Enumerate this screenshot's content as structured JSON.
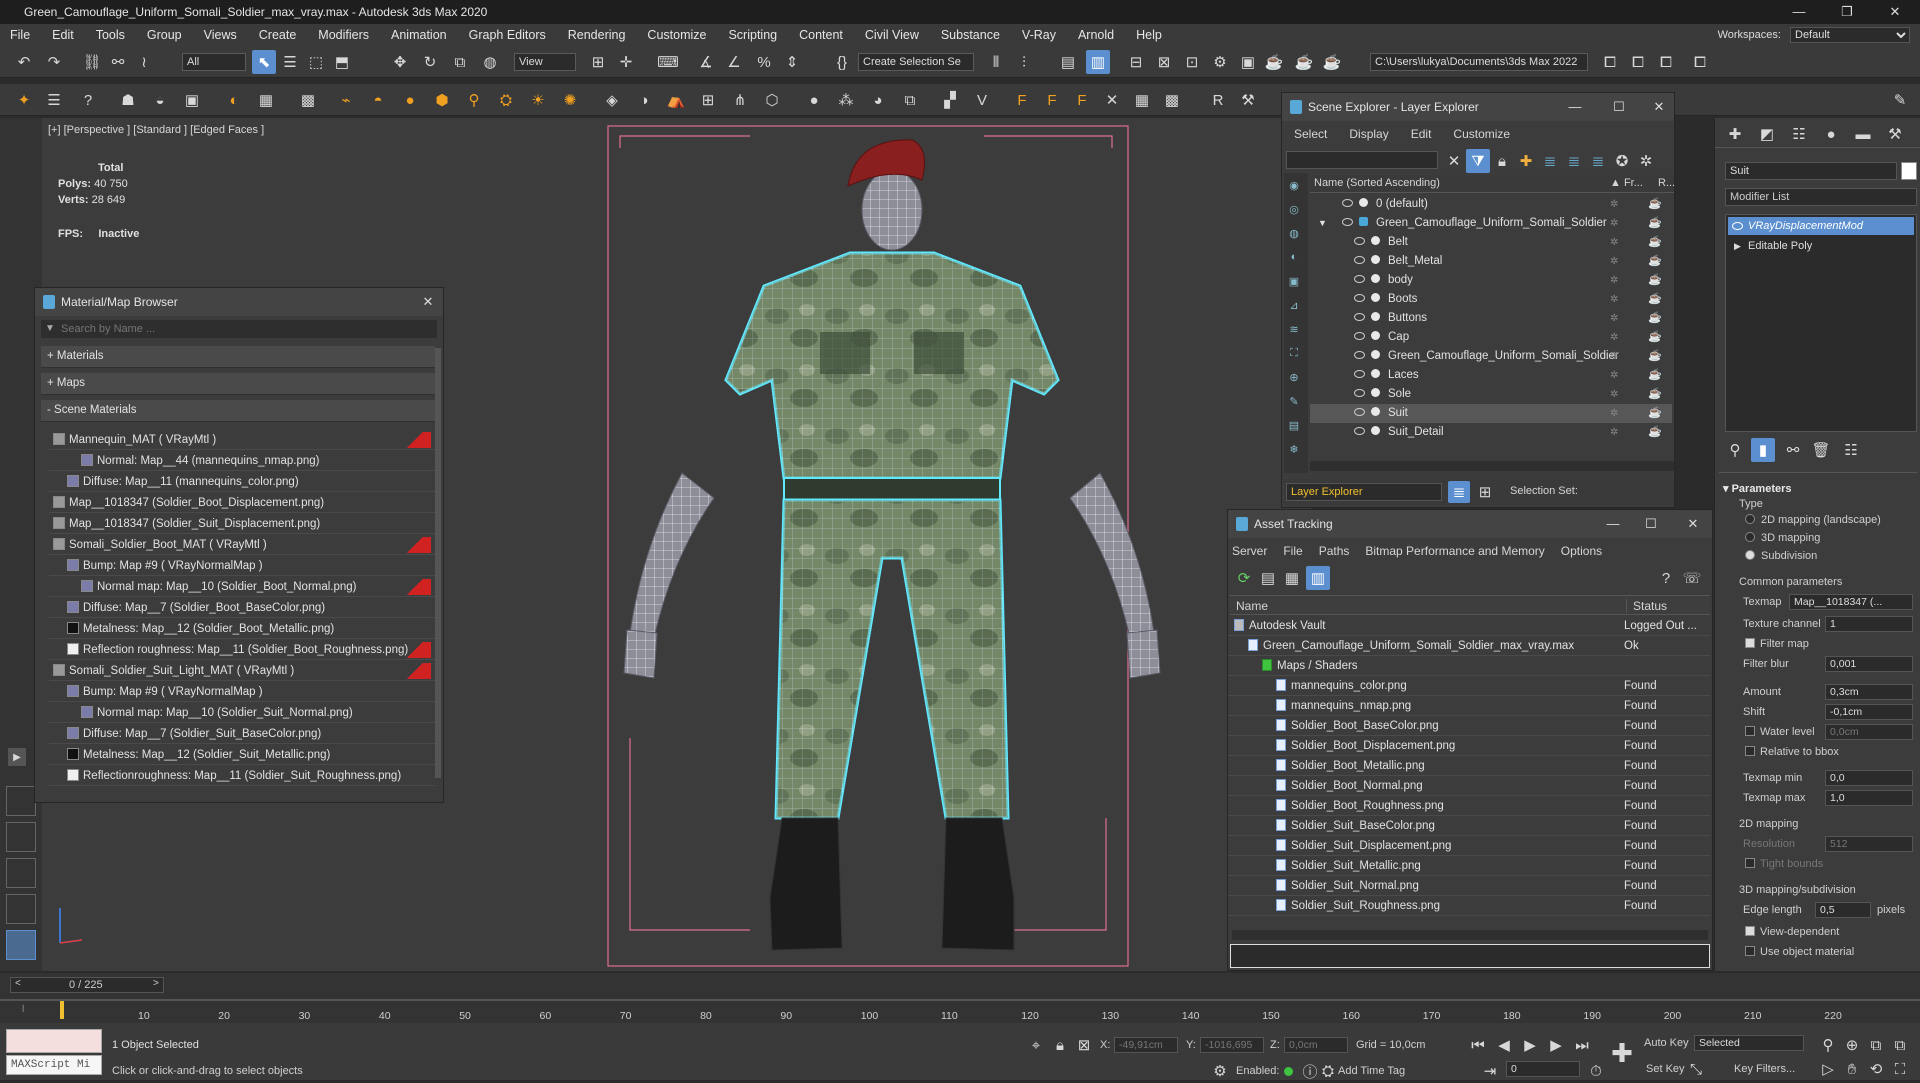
{
  "window": {
    "title": "Green_Camouflage_Uniform_Somali_Soldier_max_vray.max - Autodesk 3ds Max 2020"
  },
  "menu": [
    "File",
    "Edit",
    "Tools",
    "Group",
    "Views",
    "Create",
    "Modifiers",
    "Animation",
    "Graph Editors",
    "Rendering",
    "Customize",
    "Scripting",
    "Content",
    "Civil View",
    "Substance",
    "V-Ray",
    "Arnold",
    "Help"
  ],
  "workspace": {
    "label": "Workspaces:",
    "value": "Default"
  },
  "toolbar": {
    "filter": "All",
    "refcoord": "View",
    "selection_set": "Create Selection Se",
    "path": "C:\\Users\\lukya\\Documents\\3ds Max 2022"
  },
  "viewport": {
    "label": "[+] [Perspective ] [Standard ] [Edged Faces ]",
    "stats": {
      "total": "Total",
      "polys_label": "Polys:",
      "polys": "40 750",
      "verts_label": "Verts:",
      "verts": "28 649",
      "fps_label": "FPS:",
      "fps": "Inactive"
    }
  },
  "material_browser": {
    "title": "Material/Map Browser",
    "search_placeholder": "Search by Name ...",
    "groups": [
      "+ Materials",
      "+ Maps",
      "- Scene Materials"
    ],
    "items": [
      {
        "text": "Mannequin_MAT ( VRayMtl )",
        "indent": 0,
        "flag": true
      },
      {
        "text": "Normal: Map__44 (mannequins_nmap.png)",
        "indent": 2,
        "flag": false
      },
      {
        "text": "Diffuse: Map__11 (mannequins_color.png)",
        "indent": 1,
        "flag": false
      },
      {
        "text": "Map__1018347 (Soldier_Boot_Displacement.png)",
        "indent": 0,
        "flag": false
      },
      {
        "text": "Map__1018347 (Soldier_Suit_Displacement.png)",
        "indent": 0,
        "flag": false
      },
      {
        "text": "Somali_Soldier_Boot_MAT ( VRayMtl )",
        "indent": 0,
        "flag": true
      },
      {
        "text": "Bump: Map #9 ( VRayNormalMap )",
        "indent": 1,
        "flag": false
      },
      {
        "text": "Normal map: Map__10 (Soldier_Boot_Normal.png)",
        "indent": 2,
        "flag": true
      },
      {
        "text": "Diffuse: Map__7 (Soldier_Boot_BaseColor.png)",
        "indent": 1,
        "flag": false
      },
      {
        "text": "Metalness: Map__12 (Soldier_Boot_Metallic.png)",
        "indent": 1,
        "flag": false
      },
      {
        "text": "Reflection roughness: Map__11 (Soldier_Boot_Roughness.png)",
        "indent": 1,
        "flag": true
      },
      {
        "text": "Somali_Soldier_Suit_Light_MAT ( VRayMtl )",
        "indent": 0,
        "flag": true
      },
      {
        "text": "Bump: Map #9 ( VRayNormalMap )",
        "indent": 1,
        "flag": false
      },
      {
        "text": "Normal map: Map__10 (Soldier_Suit_Normal.png)",
        "indent": 2,
        "flag": false
      },
      {
        "text": "Diffuse: Map__7 (Soldier_Suit_BaseColor.png)",
        "indent": 1,
        "flag": false
      },
      {
        "text": "Metalness: Map__12 (Soldier_Suit_Metallic.png)",
        "indent": 1,
        "flag": false
      },
      {
        "text": "Reflectionroughness: Map__11 (Soldier_Suit_Roughness.png)",
        "indent": 1,
        "flag": false
      }
    ]
  },
  "scene_explorer": {
    "title": "Scene Explorer - Layer Explorer",
    "menu": [
      "Select",
      "Display",
      "Edit",
      "Customize"
    ],
    "col_name": "Name (Sorted Ascending)",
    "col_fr": "▲ Fr...",
    "col_r": "R...",
    "rows": [
      {
        "name": "0 (default)",
        "level": 0,
        "selected": false
      },
      {
        "name": "Green_Camouflage_Uniform_Somali_Soldier",
        "level": 0,
        "selected": false
      },
      {
        "name": "Belt",
        "level": 1,
        "selected": false
      },
      {
        "name": "Belt_Metal",
        "level": 1,
        "selected": false
      },
      {
        "name": "body",
        "level": 1,
        "selected": false
      },
      {
        "name": "Boots",
        "level": 1,
        "selected": false
      },
      {
        "name": "Buttons",
        "level": 1,
        "selected": false
      },
      {
        "name": "Cap",
        "level": 1,
        "selected": false
      },
      {
        "name": "Green_Camouflage_Uniform_Somali_Soldier",
        "level": 1,
        "selected": false
      },
      {
        "name": "Laces",
        "level": 1,
        "selected": false
      },
      {
        "name": "Sole",
        "level": 1,
        "selected": false
      },
      {
        "name": "Suit",
        "level": 1,
        "selected": true
      },
      {
        "name": "Suit_Detail",
        "level": 1,
        "selected": false
      }
    ],
    "footer_explorer": "Layer Explorer",
    "footer_selset": "Selection Set:"
  },
  "asset_tracking": {
    "title": "Asset Tracking",
    "menu": [
      "Server",
      "File",
      "Paths",
      "Bitmap Performance and Memory",
      "Options"
    ],
    "col_name": "Name",
    "col_status": "Status",
    "rows": [
      {
        "name": "Autodesk Vault",
        "status": "Logged Out ...",
        "indent": 0
      },
      {
        "name": "Green_Camouflage_Uniform_Somali_Soldier_max_vray.max",
        "status": "Ok",
        "indent": 1
      },
      {
        "name": "Maps / Shaders",
        "status": "",
        "indent": 2
      },
      {
        "name": "mannequins_color.png",
        "status": "Found",
        "indent": 3
      },
      {
        "name": "mannequins_nmap.png",
        "status": "Found",
        "indent": 3
      },
      {
        "name": "Soldier_Boot_BaseColor.png",
        "status": "Found",
        "indent": 3
      },
      {
        "name": "Soldier_Boot_Displacement.png",
        "status": "Found",
        "indent": 3
      },
      {
        "name": "Soldier_Boot_Metallic.png",
        "status": "Found",
        "indent": 3
      },
      {
        "name": "Soldier_Boot_Normal.png",
        "status": "Found",
        "indent": 3
      },
      {
        "name": "Soldier_Boot_Roughness.png",
        "status": "Found",
        "indent": 3
      },
      {
        "name": "Soldier_Suit_BaseColor.png",
        "status": "Found",
        "indent": 3
      },
      {
        "name": "Soldier_Suit_Displacement.png",
        "status": "Found",
        "indent": 3
      },
      {
        "name": "Soldier_Suit_Metallic.png",
        "status": "Found",
        "indent": 3
      },
      {
        "name": "Soldier_Suit_Normal.png",
        "status": "Found",
        "indent": 3
      },
      {
        "name": "Soldier_Suit_Roughness.png",
        "status": "Found",
        "indent": 3
      }
    ]
  },
  "command_panel": {
    "object_name": "Suit",
    "modifier_list": "Modifier List",
    "stack": [
      "VRayDisplacementMod",
      "Editable Poly"
    ],
    "parameters": "Parameters",
    "type_label": "Type",
    "type_options": [
      "2D mapping (landscape)",
      "3D mapping",
      "Subdivision"
    ],
    "common_params": "Common parameters",
    "texmap_label": "Texmap",
    "texmap": "Map__1018347 (...",
    "texture_channel_label": "Texture channel",
    "texture_channel": "1",
    "filter_map": "Filter map",
    "filter_blur_label": "Filter blur",
    "filter_blur": "0,001",
    "amount_label": "Amount",
    "amount": "0,3cm",
    "shift_label": "Shift",
    "shift": "-0,1cm",
    "water_level_label": "Water level",
    "water_level": "0,0cm",
    "relative_bbox": "Relative to bbox",
    "texmap_min_label": "Texmap min",
    "texmap_min": "0,0",
    "texmap_max_label": "Texmap max",
    "texmap_max": "1,0",
    "mapping2d": "2D mapping",
    "resolution_label": "Resolution",
    "resolution": "512",
    "tight_bounds": "Tight bounds",
    "mapping3d": "3D mapping/subdivision",
    "edge_length_label": "Edge length",
    "edge_length": "0,5",
    "pixels": "pixels",
    "view_dependent": "View-dependent",
    "use_object_material": "Use object material"
  },
  "timeline": {
    "frame": "0 / 225",
    "ticks": [
      "10",
      "20",
      "30",
      "40",
      "50",
      "60",
      "70",
      "80",
      "90",
      "100",
      "110",
      "120",
      "130",
      "140",
      "150",
      "160",
      "170",
      "180",
      "190",
      "200",
      "210",
      "220"
    ]
  },
  "status": {
    "maxscript": "MAXScript Mi",
    "selected": "1 Object Selected",
    "hint": "Click or click-and-drag to select objects",
    "x_label": "X:",
    "x": "-49,91cm",
    "y_label": "Y:",
    "y": "-1016,695",
    "z_label": "Z:",
    "z": "0,0cm",
    "grid": "Grid = 10,0cm",
    "enabled": "Enabled:",
    "add_time_tag": "Add Time Tag",
    "autokey": "Auto Key",
    "selected_set": "Selected",
    "setkey": "Set Key",
    "key_filters": "Key Filters...",
    "frame_field": "0"
  },
  "colors": {
    "accent": "#5b8fcf",
    "wire": "#5fe8ff",
    "flag": "#d12222",
    "safe_frame": "#e07090"
  }
}
